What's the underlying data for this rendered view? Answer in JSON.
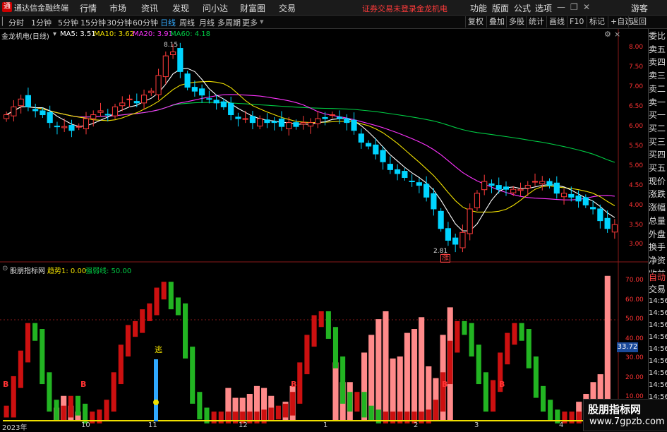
{
  "titlebar": {
    "app_title": "通达信金融终端",
    "menu": [
      "行情",
      "市场",
      "资讯",
      "发现",
      "问小达",
      "财富圈",
      "交易"
    ],
    "warning": "证券交易未登录",
    "stock_name_top": "金龙机电",
    "right": [
      "功能",
      "版面",
      "公式",
      "选项"
    ],
    "guest": "游客"
  },
  "toolbar": {
    "periods": [
      "分时",
      "1分钟",
      "5分钟",
      "15分钟",
      "30分钟",
      "60分钟",
      "日线",
      "周线",
      "月线",
      "多周期",
      "更多"
    ],
    "active": "日线",
    "right": [
      "复权",
      "叠加",
      "多股",
      "统计",
      "画线",
      "F10",
      "标记",
      "+自选",
      "返回"
    ]
  },
  "main_legend": {
    "title": "金龙机电(日线)",
    "ma5": "MA5: 3.51",
    "ma10": "MA10: 3.62",
    "ma20": "MA20: 3.91",
    "ma60": "MA60: 4.18"
  },
  "price_axis": [
    "8.00",
    "7.50",
    "7.00",
    "6.50",
    "6.00",
    "5.50",
    "5.00",
    "4.50",
    "4.00",
    "3.50",
    "3.00"
  ],
  "annotations": {
    "high": "8.15",
    "low": "2.81",
    "zhang": "涨"
  },
  "indicator_legend": {
    "title": "股朋指标网",
    "trend": "趋势1: 0.00",
    "strong_weak": "强弱线: 50.00"
  },
  "indicator_axis": [
    "70.00",
    "60.00",
    "50.00",
    "40.00",
    "30.00",
    "20.00",
    "10.00"
  ],
  "indicator_marks": {
    "escape": "逃",
    "buy": "B"
  },
  "indicator_value_badge": "33.72",
  "time_axis": [
    "2023年",
    "10",
    "11",
    "12",
    "1",
    "2",
    "3",
    "4"
  ],
  "right_panel": {
    "labels": [
      "委比",
      "卖五",
      "卖四",
      "卖三",
      "卖二",
      "卖一",
      "买一",
      "买二",
      "买三",
      "买四",
      "买五",
      "现价",
      "涨跌",
      "涨幅",
      "总量",
      "外盘",
      "换手",
      "净资",
      "收益"
    ],
    "auto": "自动",
    "trade": "交易",
    "times": [
      "14:56",
      "14:56",
      "14:56",
      "14:56",
      "14:56",
      "14:56",
      "14:56",
      "14:56",
      "14:56",
      "14:56",
      "14:56"
    ]
  },
  "watermark": {
    "line1": "股朋指标网",
    "line2": "www.7gpzb.com"
  },
  "colors": {
    "up": "#ff3b3b",
    "down": "#00d4ff",
    "ma5": "#ffffff",
    "ma10": "#f0e000",
    "ma20": "#ff33ff",
    "ma60": "#00cc44",
    "bar_pink": "#ff8a8a",
    "ind_red": "#cc1010",
    "ind_green": "#22b422"
  },
  "chart_data": [
    {
      "type": "candlestick",
      "title": "金龙机电(日线)",
      "ylim": [
        2.8,
        8.5
      ],
      "close": [
        6.3,
        6.5,
        6.7,
        6.5,
        6.4,
        6.3,
        6.1,
        6.0,
        6.0,
        5.9,
        6.0,
        6.2,
        6.3,
        6.4,
        6.3,
        6.5,
        6.6,
        6.7,
        6.6,
        6.8,
        6.9,
        7.3,
        7.8,
        7.9,
        7.4,
        7.0,
        6.9,
        6.8,
        6.7,
        6.6,
        6.5,
        6.3,
        6.2,
        6.2,
        6.1,
        6.2,
        6.1,
        6.1,
        6.0,
        6.1,
        6.0,
        6.1,
        6.1,
        6.2,
        6.2,
        6.3,
        6.2,
        6.1,
        5.9,
        5.6,
        5.5,
        5.3,
        5.1,
        4.9,
        4.8,
        4.7,
        4.6,
        4.5,
        4.2,
        3.9,
        3.4,
        3.1,
        3.0,
        3.3,
        3.9,
        4.3,
        4.6,
        4.5,
        4.4,
        4.4,
        4.4,
        4.4,
        4.5,
        4.6,
        4.6,
        4.5,
        4.3,
        4.3,
        4.2,
        4.1,
        4.0,
        3.9,
        3.6,
        3.4,
        3.5
      ],
      "ma5": 3.51,
      "ma10": 3.62,
      "ma20": 3.91,
      "ma60": 4.18
    },
    {
      "type": "bar",
      "title": "股朋指标网",
      "ylim": [
        0,
        75
      ],
      "trend_line": [
        5,
        20,
        33,
        47,
        44,
        22,
        8,
        3,
        5,
        10,
        6,
        2,
        2,
        3,
        8,
        22,
        36,
        46,
        48,
        54,
        57,
        65,
        68,
        60,
        57,
        35,
        12,
        4,
        2,
        2,
        2,
        2,
        2,
        2,
        2,
        2,
        3,
        4,
        5,
        6,
        12,
        27,
        41,
        51,
        53,
        45,
        30,
        12,
        8,
        12,
        5,
        3,
        2,
        2,
        2,
        2,
        2,
        2,
        2,
        3,
        8,
        22,
        38,
        48,
        47,
        36,
        22,
        8,
        18,
        32,
        42,
        47,
        44,
        30,
        15,
        8,
        3,
        2,
        2,
        2,
        2,
        3,
        4,
        5,
        6,
        7
      ],
      "pink_bars": [
        0,
        0,
        0,
        0,
        0,
        0,
        0,
        7,
        13,
        8,
        5,
        0,
        0,
        0,
        0,
        0,
        0,
        0,
        0,
        0,
        0,
        0,
        0,
        0,
        0,
        0,
        0,
        0,
        0,
        0,
        0,
        17,
        12,
        12,
        14,
        18,
        17,
        13,
        0,
        10,
        18,
        0,
        0,
        0,
        0,
        0,
        30,
        20,
        20,
        0,
        35,
        44,
        52,
        56,
        32,
        33,
        45,
        47,
        53,
        28,
        22,
        44,
        58,
        0,
        0,
        0,
        0,
        0,
        0,
        0,
        0,
        0,
        0,
        0,
        0,
        0,
        0,
        0,
        0,
        0,
        10,
        14,
        20,
        24,
        74
      ]
    }
  ]
}
